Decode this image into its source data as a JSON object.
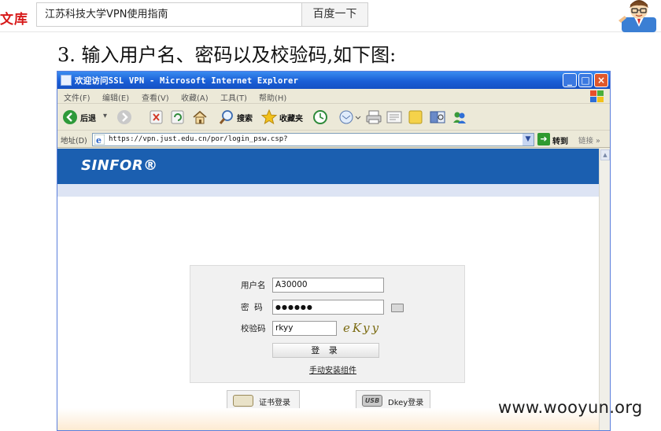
{
  "search": {
    "brand": "文库",
    "query": "江苏科技大学VPN使用指南",
    "button_label": "百度一下"
  },
  "doc": {
    "heading": "3. 输入用户名、密码以及校验码,如下图:"
  },
  "browser": {
    "window_title": "欢迎访问SSL VPN - Microsoft Internet Explorer",
    "window_buttons": [
      "_",
      "□",
      "×"
    ],
    "menu": [
      "文件(F)",
      "编辑(E)",
      "查看(V)",
      "收藏(A)",
      "工具(T)",
      "帮助(H)"
    ],
    "toolbar": {
      "back_label": "后退",
      "search_label": "搜索",
      "favorites_label": "收藏夹"
    },
    "address": {
      "label": "地址(D)",
      "url": "https://vpn.just.edu.cn/por/login_psw.csp?",
      "go_label": "转到",
      "links_label": "链接 »"
    }
  },
  "page": {
    "logo": "SINFOR®",
    "login": {
      "username_label": "用户名",
      "username_value": "A30000",
      "password_label": "密  码",
      "password_value": "●●●●●●",
      "captcha_label": "校验码",
      "captcha_input_value": "rkyy",
      "captcha_image_text": "eKyy",
      "submit_label": "登 录",
      "install_link": "手动安装组件"
    },
    "cert_login_label": "证书登录",
    "dkey_login_label": "Dkey登录",
    "usb_badge": "USB"
  },
  "watermark": "www.wooyun.org",
  "colors": {
    "brand_red": "#d71a1a",
    "titlebar_blue": "#1a5fd6",
    "banner_blue": "#1b5fb0"
  }
}
